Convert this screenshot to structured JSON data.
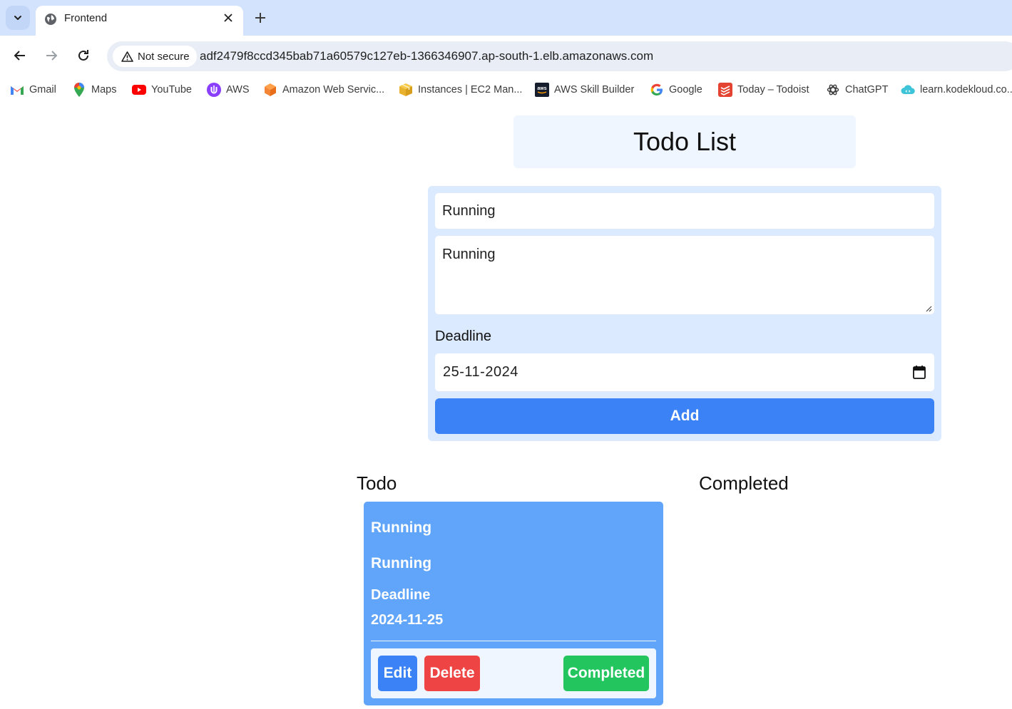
{
  "browser": {
    "tab": {
      "title": "Frontend"
    },
    "omnibox": {
      "security_label": "Not secure",
      "url": "adf2479f8ccd345bab71a60579c127eb-1366346907.ap-south-1.elb.amazonaws.com"
    },
    "bookmarks": [
      {
        "label": "Gmail",
        "icon": "gmail-icon"
      },
      {
        "label": "Maps",
        "icon": "maps-icon"
      },
      {
        "label": "YouTube",
        "icon": "youtube-icon"
      },
      {
        "label": "AWS",
        "icon": "aws-icon"
      },
      {
        "label": "Amazon Web Servic...",
        "icon": "aws-cube-icon"
      },
      {
        "label": "Instances | EC2 Man...",
        "icon": "ec2-box-icon"
      },
      {
        "label": "AWS Skill Builder",
        "icon": "aws-skill-builder-icon"
      },
      {
        "label": "Google",
        "icon": "google-icon"
      },
      {
        "label": "Today – Todoist",
        "icon": "todoist-icon"
      },
      {
        "label": "ChatGPT",
        "icon": "chatgpt-icon"
      },
      {
        "label": "learn.kodekloud.co...",
        "icon": "kodekloud-icon"
      }
    ]
  },
  "app": {
    "title": "Todo List",
    "form": {
      "title_value": "Running",
      "description_value": "Running",
      "deadline_label": "Deadline",
      "deadline_value": "25-11-2024",
      "add_label": "Add"
    },
    "columns": {
      "todo_heading": "Todo",
      "completed_heading": "Completed"
    },
    "todos": [
      {
        "title": "Running",
        "description": "Running",
        "deadline_label": "Deadline",
        "deadline": "2024-11-25",
        "edit_label": "Edit",
        "delete_label": "Delete",
        "complete_label": "Completed"
      }
    ]
  },
  "colors": {
    "form_bg": "#dbeafe",
    "card_bg": "#60a5fa",
    "primary": "#3b82f6",
    "danger": "#ef4444",
    "success": "#22c55e"
  }
}
